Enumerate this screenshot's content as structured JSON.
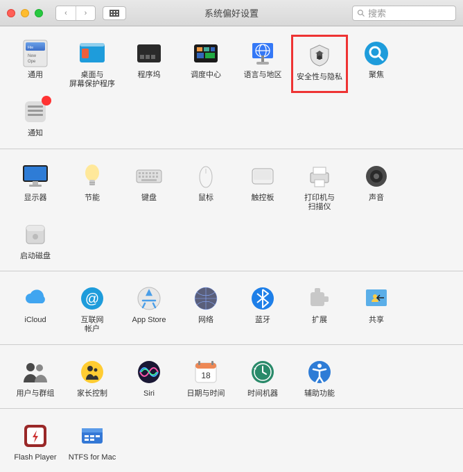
{
  "titlebar": {
    "title": "系统偏好设置",
    "searchPlaceholder": "搜索"
  },
  "sections": [
    {
      "items": [
        {
          "id": "general",
          "label": "通用"
        },
        {
          "id": "desktop",
          "label": "桌面与\n屏幕保护程序"
        },
        {
          "id": "dock",
          "label": "程序坞"
        },
        {
          "id": "mission",
          "label": "调度中心"
        },
        {
          "id": "language",
          "label": "语言与地区"
        },
        {
          "id": "security",
          "label": "安全性与隐私",
          "highlighted": true
        },
        {
          "id": "spotlight",
          "label": "聚焦"
        },
        {
          "id": "notifications",
          "label": "通知",
          "badge": true
        }
      ]
    },
    {
      "items": [
        {
          "id": "displays",
          "label": "显示器"
        },
        {
          "id": "energy",
          "label": "节能"
        },
        {
          "id": "keyboard",
          "label": "键盘"
        },
        {
          "id": "mouse",
          "label": "鼠标"
        },
        {
          "id": "trackpad",
          "label": "触控板"
        },
        {
          "id": "printers",
          "label": "打印机与\n扫描仪"
        },
        {
          "id": "sound",
          "label": "声音"
        },
        {
          "id": "startup",
          "label": "启动磁盘"
        }
      ]
    },
    {
      "items": [
        {
          "id": "icloud",
          "label": "iCloud"
        },
        {
          "id": "internet",
          "label": "互联网\n帐户"
        },
        {
          "id": "appstore",
          "label": "App Store"
        },
        {
          "id": "network",
          "label": "网络"
        },
        {
          "id": "bluetooth",
          "label": "蓝牙"
        },
        {
          "id": "extensions",
          "label": "扩展"
        },
        {
          "id": "sharing",
          "label": "共享"
        }
      ]
    },
    {
      "items": [
        {
          "id": "users",
          "label": "用户与群组"
        },
        {
          "id": "parental",
          "label": "家长控制"
        },
        {
          "id": "siri",
          "label": "Siri"
        },
        {
          "id": "datetime",
          "label": "日期与时间"
        },
        {
          "id": "timemachine",
          "label": "时间机器"
        },
        {
          "id": "accessibility",
          "label": "辅助功能"
        }
      ]
    },
    {
      "items": [
        {
          "id": "flash",
          "label": "Flash Player"
        },
        {
          "id": "ntfs",
          "label": "NTFS for Mac"
        }
      ]
    }
  ]
}
